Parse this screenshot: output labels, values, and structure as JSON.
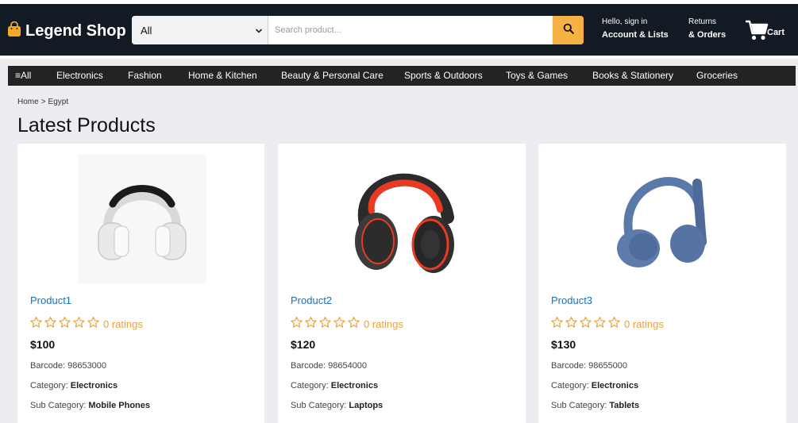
{
  "header": {
    "logo": "Legend Shop",
    "search_category": "All",
    "search_placeholder": "Search product...",
    "account_line1": "Hello, sign in",
    "account_line2": "Account & Lists",
    "returns_line1": "Returns",
    "returns_line2": "& Orders",
    "cart_label": "Cart"
  },
  "nav": {
    "items": [
      {
        "label": "≡All"
      },
      {
        "label": "Electronics"
      },
      {
        "label": "Fashion"
      },
      {
        "label": "Home & Kitchen"
      },
      {
        "label": "Beauty & Personal Care"
      },
      {
        "label": "Sports & Outdoors"
      },
      {
        "label": "Toys & Games"
      },
      {
        "label": "Books & Stationery"
      },
      {
        "label": "Groceries"
      }
    ]
  },
  "breadcrumb": {
    "home": "Home",
    "separator": ">",
    "current": "Egypt"
  },
  "page_title": "Latest Products",
  "colors": {
    "header_bg": "#121a23",
    "nav_bg": "#232323",
    "accent": "#f7b043",
    "link": "#1f6fb5",
    "star": "#e8a33d"
  },
  "products": [
    {
      "name": "Product1",
      "ratings": "0 ratings",
      "price": "$100",
      "barcode_label": "Barcode:",
      "barcode": "98653000",
      "category_label": "Category:",
      "category": "Electronics",
      "subcategory_label": "Sub Category:",
      "subcategory": "Mobile Phones",
      "image": "white-headphones"
    },
    {
      "name": "Product2",
      "ratings": "0 ratings",
      "price": "$120",
      "barcode_label": "Barcode:",
      "barcode": "98654000",
      "category_label": "Category:",
      "category": "Electronics",
      "subcategory_label": "Sub Category:",
      "subcategory": "Laptops",
      "image": "red-black-headphones"
    },
    {
      "name": "Product3",
      "ratings": "0 ratings",
      "price": "$130",
      "barcode_label": "Barcode:",
      "barcode": "98655000",
      "category_label": "Category:",
      "category": "Electronics",
      "subcategory_label": "Sub Category:",
      "subcategory": "Tablets",
      "image": "blue-headphones"
    }
  ]
}
